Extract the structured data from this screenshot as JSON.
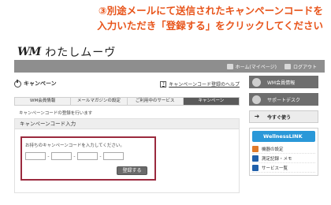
{
  "instruction": {
    "line1": "③別途メールにて送信されたキャンペーンコードを",
    "line2": "入力いただき「登録する」をクリックしてください"
  },
  "logo": {
    "mark": "WM",
    "text": "わたしムーヴ"
  },
  "topbar": {
    "home_label": "ホーム(マイページ)",
    "logout_label": "ログアウト"
  },
  "page": {
    "title": "キャンペーン",
    "help_link": "キャンペーンコード登録のヘルプ",
    "tabs": [
      {
        "label": "WM会員情報"
      },
      {
        "label": "メールマガジンの設定"
      },
      {
        "label": "ご利用中のサービス"
      },
      {
        "label": "キャンペーン"
      }
    ],
    "notice": "キャンペーンコードの登録を行います",
    "section_title": "キャンペーンコード入力",
    "input_label": "お持ちのキャンペーンコードを入力してください。",
    "dash": "-",
    "register_label": "登録する"
  },
  "sidebar": {
    "member_info": "WM会員情報",
    "support_desk": "サポートデスク",
    "use_now": "今すぐ使う",
    "wellness_banner": "WellnessLINK",
    "wellness_items": [
      {
        "label": "機器の設定",
        "icon": "device-icon"
      },
      {
        "label": "測定記録・メモ",
        "icon": "record-icon"
      },
      {
        "label": "サービス一覧",
        "icon": "list-icon"
      }
    ]
  }
}
